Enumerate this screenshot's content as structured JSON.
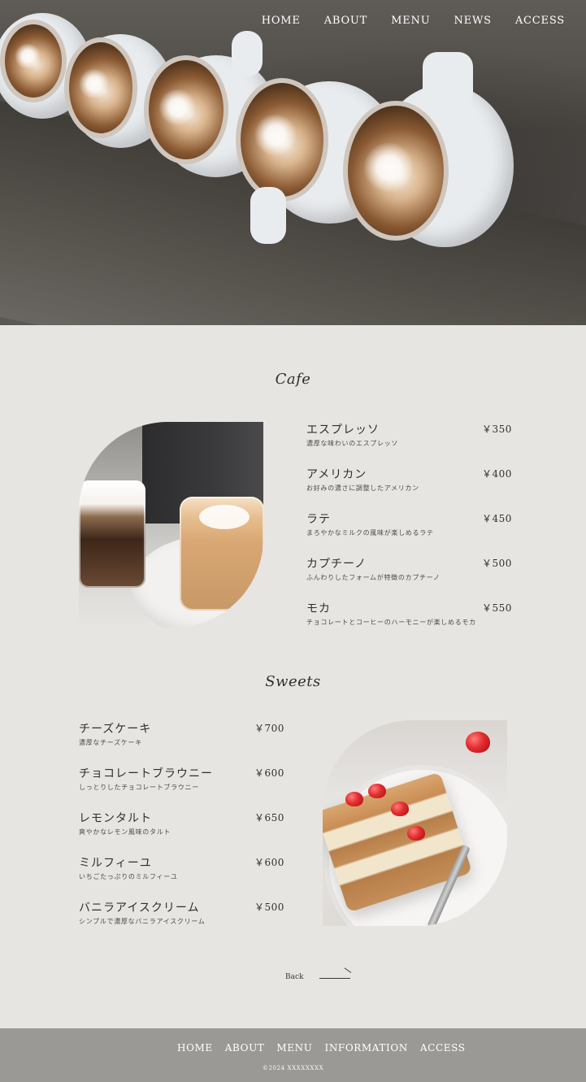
{
  "nav": {
    "items": [
      "HOME",
      "ABOUT",
      "MENU",
      "NEWS",
      "ACCESS"
    ]
  },
  "cafe": {
    "title": "Cafe",
    "items": [
      {
        "name": "エスプレッソ",
        "price": "￥350",
        "desc": "濃厚な味わいのエスプレッソ"
      },
      {
        "name": "アメリカン",
        "price": "￥400",
        "desc": "お好みの濃さに調整したアメリカン"
      },
      {
        "name": "ラテ",
        "price": "￥450",
        "desc": "まろやかなミルクの風味が楽しめるラテ"
      },
      {
        "name": "カプチーノ",
        "price": "￥500",
        "desc": "ふんわりしたフォームが特徴のカプチーノ"
      },
      {
        "name": "モカ",
        "price": "￥550",
        "desc": "チョコレートとコーヒーのハーモニーが楽しめるモカ"
      }
    ]
  },
  "sweets": {
    "title": "Sweets",
    "items": [
      {
        "name": "チーズケーキ",
        "price": "￥700",
        "desc": "濃厚なチーズケーキ"
      },
      {
        "name": "チョコレートブラウニー",
        "price": "￥600",
        "desc": "しっとりしたチョコレートブラウニー"
      },
      {
        "name": "レモンタルト",
        "price": "￥650",
        "desc": "爽やかなレモン風味のタルト"
      },
      {
        "name": "ミルフィーユ",
        "price": "￥600",
        "desc": "いちごたっぷりのミルフィーユ"
      },
      {
        "name": "バニラアイスクリーム",
        "price": "￥500",
        "desc": "シンプルで濃厚なバニラアイスクリーム"
      }
    ]
  },
  "back": {
    "label": "Back"
  },
  "footer": {
    "nav": [
      "HOME",
      "ABOUT",
      "MENU",
      "INFORMATION",
      "ACCESS"
    ],
    "copyright": "©2024 XXXXXXXX"
  }
}
